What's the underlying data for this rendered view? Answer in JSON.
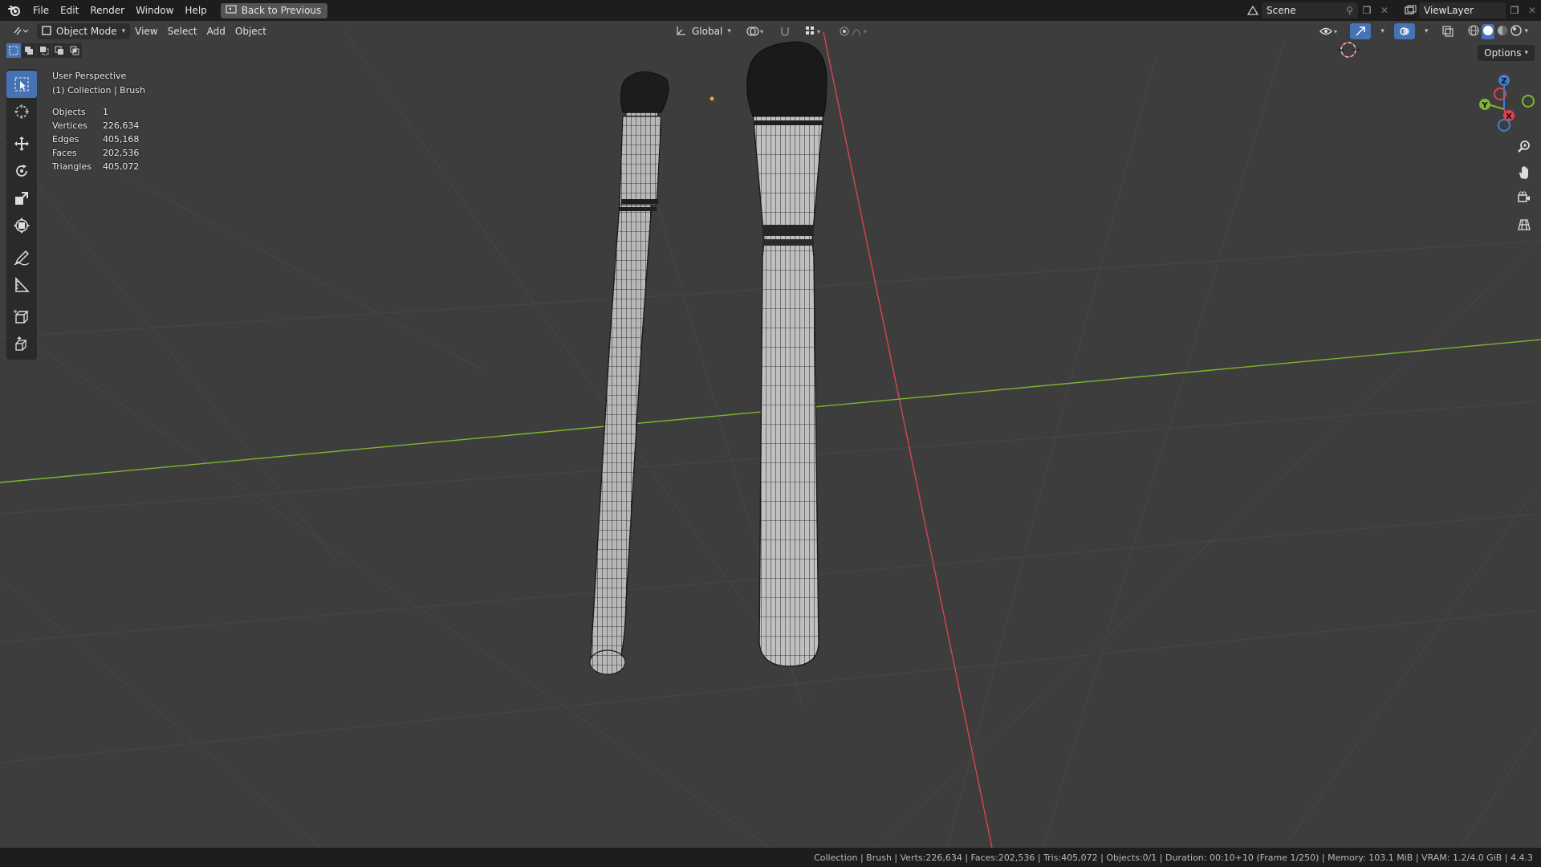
{
  "menu": {
    "items": [
      "File",
      "Edit",
      "Render",
      "Window",
      "Help"
    ],
    "back_button": "Back to Previous"
  },
  "top_right": {
    "scene": "Scene",
    "view_layer": "ViewLayer"
  },
  "viewport_header": {
    "mode": "Object Mode",
    "menus": [
      "View",
      "Select",
      "Add",
      "Object"
    ],
    "orientation": "Global",
    "options": "Options"
  },
  "overlay": {
    "perspective": "User Perspective",
    "collection": "(1) Collection | Brush",
    "stats": [
      {
        "label": "Objects",
        "value": "1"
      },
      {
        "label": "Vertices",
        "value": "226,634"
      },
      {
        "label": "Edges",
        "value": "405,168"
      },
      {
        "label": "Faces",
        "value": "202,536"
      },
      {
        "label": "Triangles",
        "value": "405,072"
      }
    ]
  },
  "status_bar": "Collection | Brush | Verts:226,634 | Faces:202,536 | Tris:405,072 | Objects:0/1 | Duration: 00:10+10 (Frame 1/250) | Memory: 103.1 MiB | VRAM: 1.2/4.0 GiB | 4.4.3",
  "gizmo": {
    "z": "Z",
    "y": "Y",
    "x": "X"
  },
  "colors": {
    "accent": "#4772b3",
    "x_axis": "#d94452",
    "y_axis": "#7fb52f",
    "z_axis": "#3d7fd1",
    "viewport_bg": "#3d3d3d"
  }
}
